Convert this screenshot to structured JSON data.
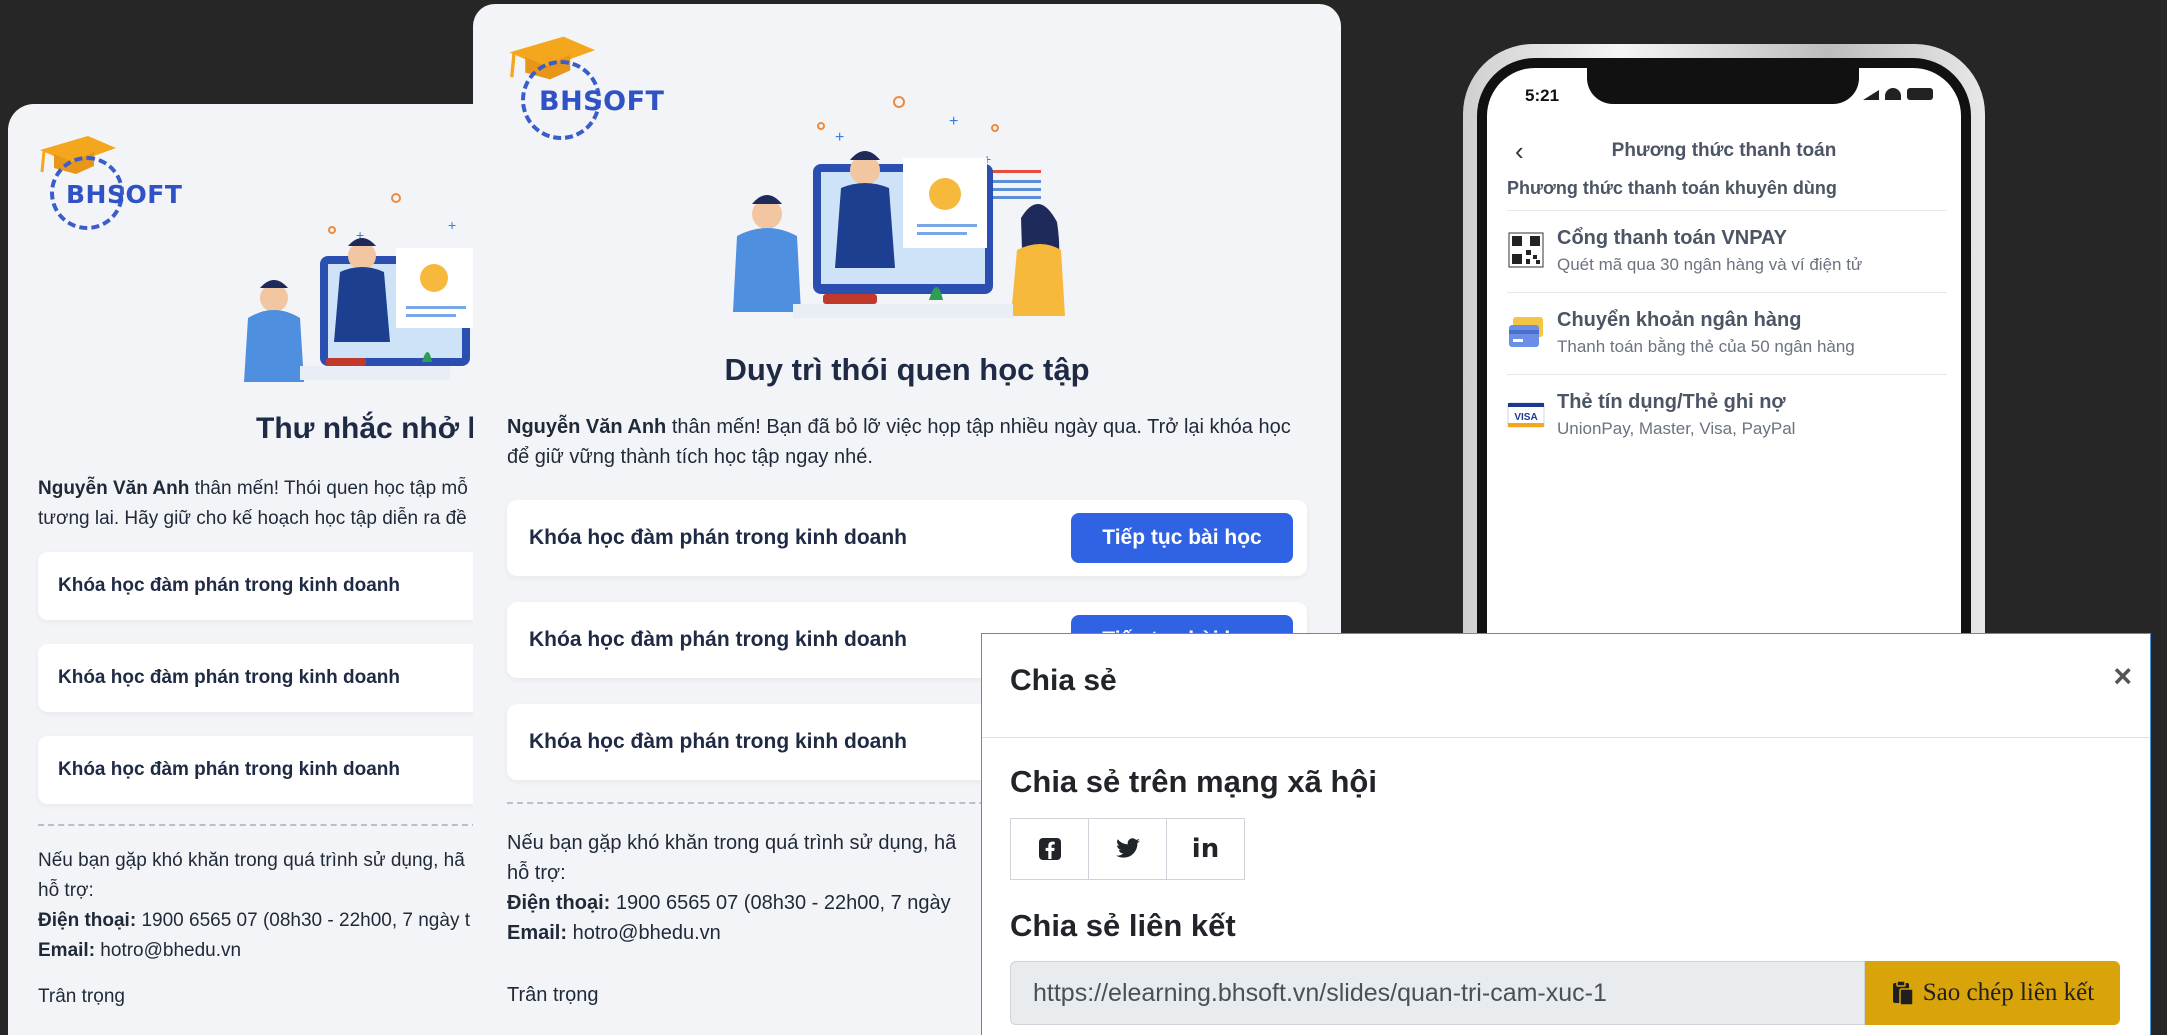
{
  "colors": {
    "primary": "#2f63e3",
    "logo_blue": "#2f52c4",
    "cap_gold": "#f4a71d",
    "copy_button": "#d9a30a"
  },
  "logo": {
    "text": "BHSOFT"
  },
  "email_left": {
    "title": "Thư nhắc nhở học",
    "intro_name": "Nguyễn Văn Anh",
    "intro_line1": " thân mến! Thói quen học tập mỗ",
    "intro_line2": "tương lai. Hãy giữ cho kế hoạch học tập diễn ra đề",
    "courses": [
      {
        "name": "Khóa học đàm phán trong kinh doanh"
      },
      {
        "name": "Khóa học đàm phán trong kinh doanh"
      },
      {
        "name": "Khóa học đàm phán trong kinh doanh"
      }
    ],
    "footer": {
      "help_line1": "Nếu bạn gặp khó khăn trong quá trình sử dụng, hã",
      "help_line2": "hỗ trợ:",
      "phone_label": "Điện thoại:",
      "phone_value": " 1900 6565 07 (08h30 - 22h00, 7 ngày t",
      "email_label": "Email:",
      "email_value": " hotro@bhedu.vn",
      "signoff": "Trân trọng"
    }
  },
  "email_center": {
    "title": "Duy trì thói quen học tập",
    "intro_name": "Nguyễn Văn Anh",
    "intro_text": " thân mến! Bạn đã bỏ lỡ việc họp tập nhiều ngày qua. Trở lại khóa học để giữ vững thành tích học tập ngay nhé.",
    "courses": [
      {
        "name": "Khóa học đàm phán trong kinh doanh",
        "button": "Tiếp tục bài học"
      },
      {
        "name": "Khóa học đàm phán trong kinh doanh",
        "button": "Tiếp tục bài học"
      },
      {
        "name": "Khóa học đàm phán trong kinh doanh"
      }
    ],
    "footer": {
      "help_line1": "Nếu bạn gặp khó khăn trong quá trình sử dụng, hã",
      "help_line2": "hỗ trợ:",
      "phone_label": "Điện thoại:",
      "phone_value": " 1900 6565 07 (08h30 - 22h00, 7 ngày",
      "email_label": "Email:",
      "email_value": " hotro@bhedu.vn",
      "signoff": "Trân trọng"
    }
  },
  "phone": {
    "time": "5:21",
    "title": "Phương thức thanh toán",
    "section_label": "Phương thức thanh toán khuyên dùng",
    "methods": [
      {
        "name": "Cổng thanh toán VNPAY",
        "desc": "Quét mã qua 30 ngân hàng và ví điện tử",
        "icon": "qr-code-icon"
      },
      {
        "name": "Chuyển khoản ngân hàng",
        "desc": "Thanh toán bằng thẻ của 50 ngân hàng",
        "icon": "bank-card-icon"
      },
      {
        "name": "Thẻ tín dụng/Thẻ ghi nợ",
        "desc": "UnionPay, Master, Visa, PayPal",
        "icon": "visa-card-icon",
        "icon_text": "VISA"
      }
    ]
  },
  "share": {
    "title": "Chia sẻ",
    "close": "×",
    "social_title": "Chia sẻ trên mạng xã hội",
    "social_buttons": [
      "facebook-icon",
      "twitter-icon",
      "linkedin-icon"
    ],
    "linkedin_text": "in",
    "link_title": "Chia sẻ liên kết",
    "link_value": "https://elearning.bhsoft.vn/slides/quan-tri-cam-xuc-1",
    "copy_label": "Sao chép liên kết"
  }
}
